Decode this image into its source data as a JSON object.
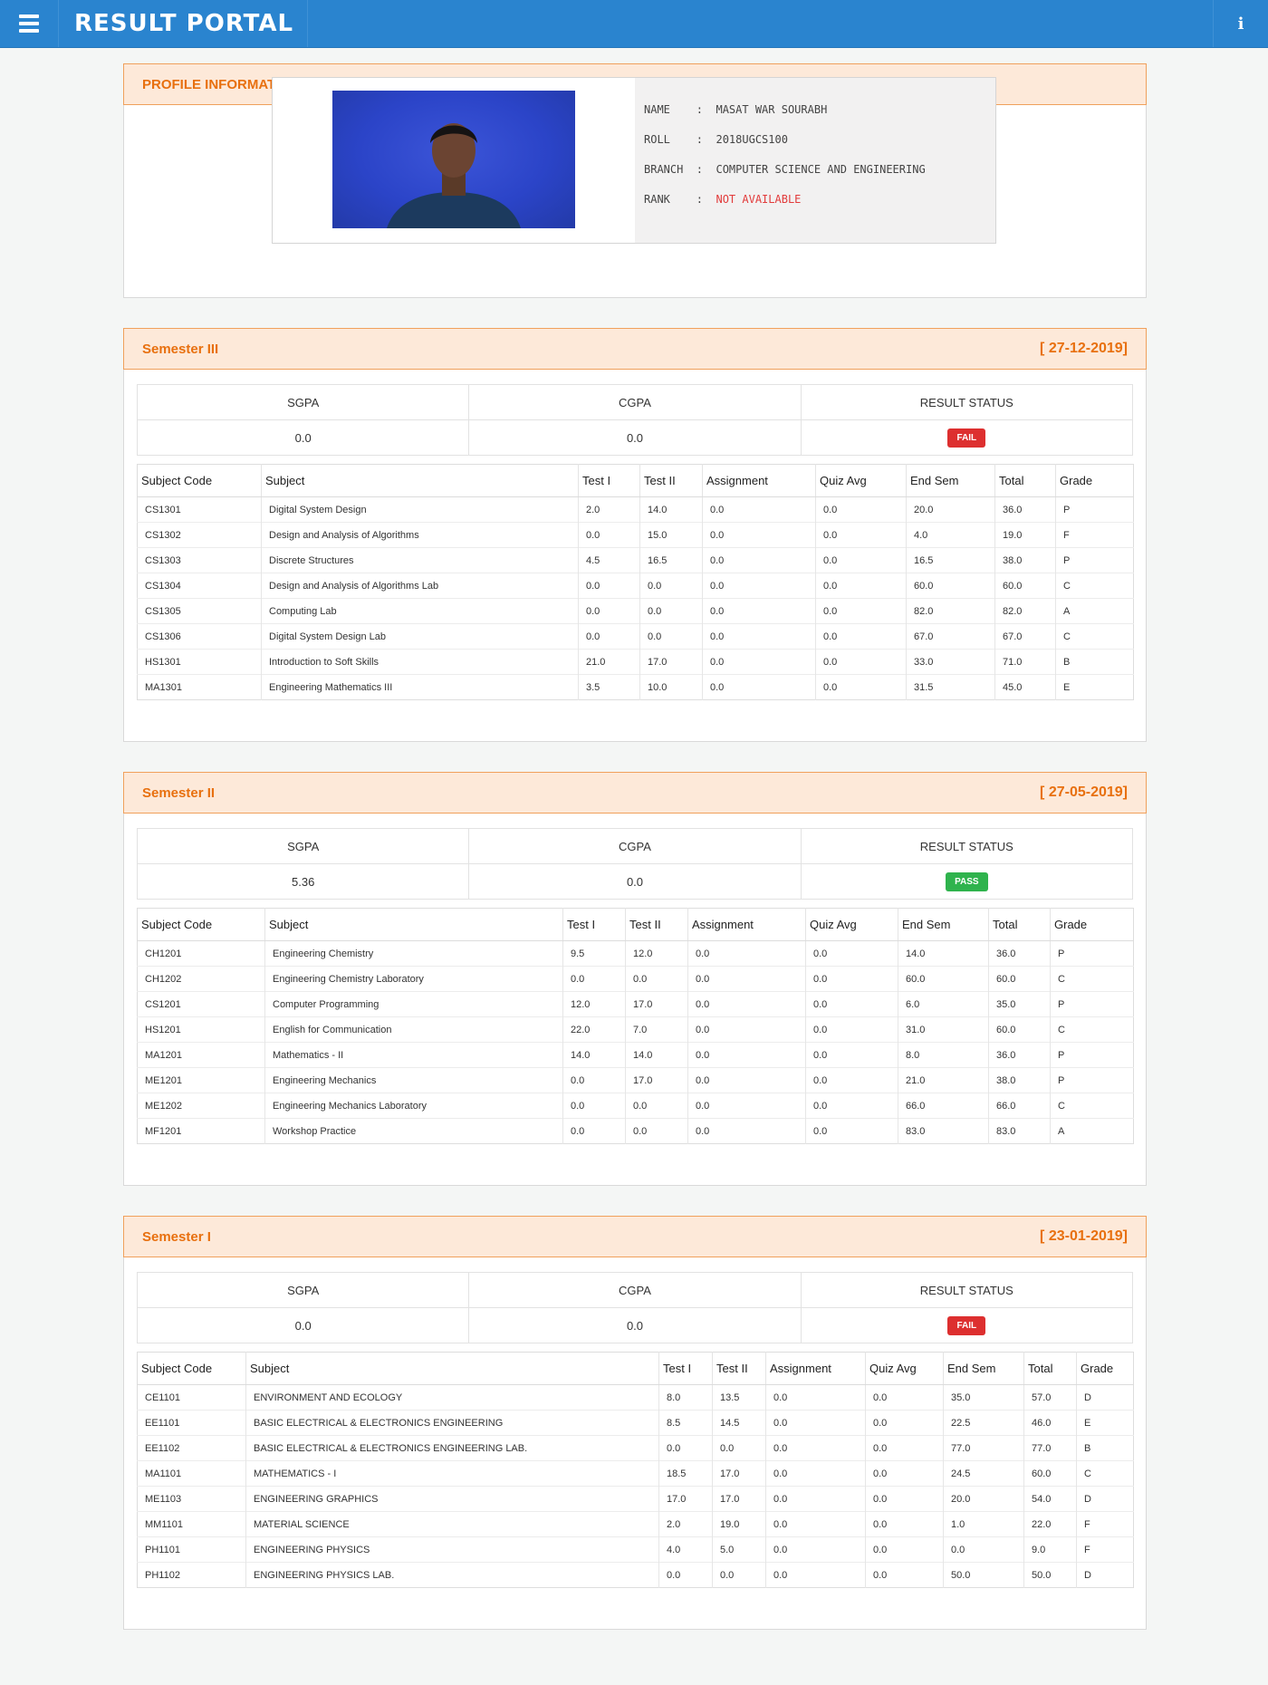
{
  "header": {
    "title": "RESULT PORTAL",
    "menu_icon": "hamburger-icon",
    "info_icon": "info-icon",
    "info_glyph": "i"
  },
  "profile": {
    "heading": "PROFILE INFORMATION",
    "rows": [
      {
        "label": "NAME",
        "value": "MASAT WAR SOURABH"
      },
      {
        "label": "ROLL",
        "value": "2018UGCS100"
      },
      {
        "label": "BRANCH",
        "value": "COMPUTER SCIENCE AND ENGINEERING"
      },
      {
        "label": "RANK",
        "value": "NOT AVAILABLE"
      }
    ]
  },
  "gpa_labels": {
    "sgpa": "SGPA",
    "cgpa": "CGPA",
    "status": "RESULT STATUS"
  },
  "columns": [
    "Subject Code",
    "Subject",
    "Test I",
    "Test II",
    "Assignment",
    "Quiz Avg",
    "End Sem",
    "Total",
    "Grade"
  ],
  "colors": {
    "accent": "#e8700f",
    "header": "#2a84cf",
    "fail": "#dd2f2f",
    "pass": "#2fb34d"
  },
  "semesters": [
    {
      "title": "Semester III",
      "date": "[ 27-12-2019]",
      "sgpa": "0.0",
      "cgpa": "0.0",
      "status": "FAIL",
      "rows": [
        [
          "CS1301",
          "Digital System Design",
          "2.0",
          "14.0",
          "0.0",
          "0.0",
          "20.0",
          "36.0",
          "P"
        ],
        [
          "CS1302",
          "Design and Analysis of Algorithms",
          "0.0",
          "15.0",
          "0.0",
          "0.0",
          "4.0",
          "19.0",
          "F"
        ],
        [
          "CS1303",
          "Discrete Structures",
          "4.5",
          "16.5",
          "0.0",
          "0.0",
          "16.5",
          "38.0",
          "P"
        ],
        [
          "CS1304",
          "Design and Analysis of Algorithms Lab",
          "0.0",
          "0.0",
          "0.0",
          "0.0",
          "60.0",
          "60.0",
          "C"
        ],
        [
          "CS1305",
          "Computing Lab",
          "0.0",
          "0.0",
          "0.0",
          "0.0",
          "82.0",
          "82.0",
          "A"
        ],
        [
          "CS1306",
          "Digital System Design Lab",
          "0.0",
          "0.0",
          "0.0",
          "0.0",
          "67.0",
          "67.0",
          "C"
        ],
        [
          "HS1301",
          "Introduction to Soft Skills",
          "21.0",
          "17.0",
          "0.0",
          "0.0",
          "33.0",
          "71.0",
          "B"
        ],
        [
          "MA1301",
          "Engineering Mathematics III",
          "3.5",
          "10.0",
          "0.0",
          "0.0",
          "31.5",
          "45.0",
          "E"
        ]
      ]
    },
    {
      "title": "Semester II",
      "date": "[ 27-05-2019]",
      "sgpa": "5.36",
      "cgpa": "0.0",
      "status": "PASS",
      "rows": [
        [
          "CH1201",
          "Engineering Chemistry",
          "9.5",
          "12.0",
          "0.0",
          "0.0",
          "14.0",
          "36.0",
          "P"
        ],
        [
          "CH1202",
          "Engineering Chemistry Laboratory",
          "0.0",
          "0.0",
          "0.0",
          "0.0",
          "60.0",
          "60.0",
          "C"
        ],
        [
          "CS1201",
          "Computer Programming",
          "12.0",
          "17.0",
          "0.0",
          "0.0",
          "6.0",
          "35.0",
          "P"
        ],
        [
          "HS1201",
          "English for Communication",
          "22.0",
          "7.0",
          "0.0",
          "0.0",
          "31.0",
          "60.0",
          "C"
        ],
        [
          "MA1201",
          "Mathematics - II",
          "14.0",
          "14.0",
          "0.0",
          "0.0",
          "8.0",
          "36.0",
          "P"
        ],
        [
          "ME1201",
          "Engineering Mechanics",
          "0.0",
          "17.0",
          "0.0",
          "0.0",
          "21.0",
          "38.0",
          "P"
        ],
        [
          "ME1202",
          "Engineering Mechanics Laboratory",
          "0.0",
          "0.0",
          "0.0",
          "0.0",
          "66.0",
          "66.0",
          "C"
        ],
        [
          "MF1201",
          "Workshop Practice",
          "0.0",
          "0.0",
          "0.0",
          "0.0",
          "83.0",
          "83.0",
          "A"
        ]
      ]
    },
    {
      "title": "Semester I",
      "date": "[ 23-01-2019]",
      "sgpa": "0.0",
      "cgpa": "0.0",
      "status": "FAIL",
      "rows": [
        [
          "CE1101",
          "ENVIRONMENT AND ECOLOGY",
          "8.0",
          "13.5",
          "0.0",
          "0.0",
          "35.0",
          "57.0",
          "D"
        ],
        [
          "EE1101",
          "BASIC ELECTRICAL & ELECTRONICS ENGINEERING",
          "8.5",
          "14.5",
          "0.0",
          "0.0",
          "22.5",
          "46.0",
          "E"
        ],
        [
          "EE1102",
          "BASIC ELECTRICAL & ELECTRONICS ENGINEERING LAB.",
          "0.0",
          "0.0",
          "0.0",
          "0.0",
          "77.0",
          "77.0",
          "B"
        ],
        [
          "MA1101",
          "MATHEMATICS - I",
          "18.5",
          "17.0",
          "0.0",
          "0.0",
          "24.5",
          "60.0",
          "C"
        ],
        [
          "ME1103",
          "ENGINEERING GRAPHICS",
          "17.0",
          "17.0",
          "0.0",
          "0.0",
          "20.0",
          "54.0",
          "D"
        ],
        [
          "MM1101",
          "MATERIAL SCIENCE",
          "2.0",
          "19.0",
          "0.0",
          "0.0",
          "1.0",
          "22.0",
          "F"
        ],
        [
          "PH1101",
          "ENGINEERING PHYSICS",
          "4.0",
          "5.0",
          "0.0",
          "0.0",
          "0.0",
          "9.0",
          "F"
        ],
        [
          "PH1102",
          "ENGINEERING PHYSICS LAB.",
          "0.0",
          "0.0",
          "0.0",
          "0.0",
          "50.0",
          "50.0",
          "D"
        ]
      ]
    }
  ]
}
